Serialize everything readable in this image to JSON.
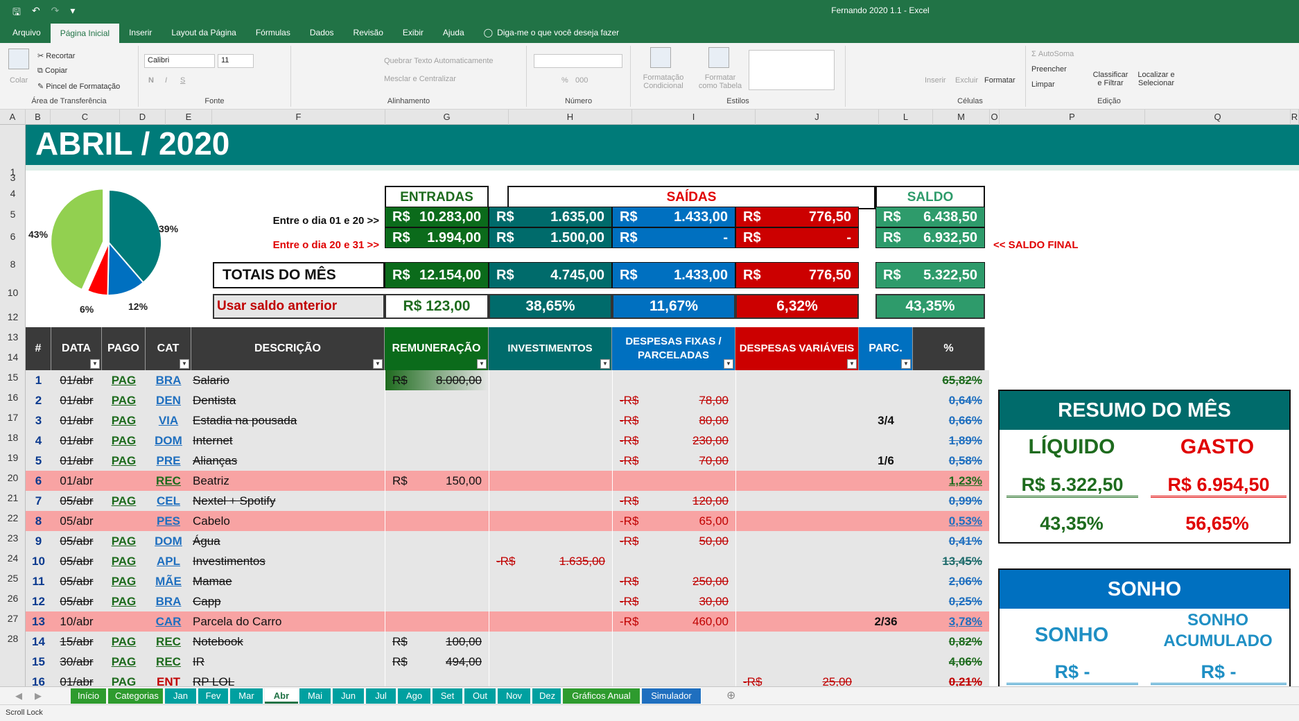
{
  "window": {
    "title": "Fernando 2020 1.1  -  Excel"
  },
  "menu": {
    "items": [
      "Arquivo",
      "Página Inicial",
      "Inserir",
      "Layout da Página",
      "Fórmulas",
      "Dados",
      "Revisão",
      "Exibir",
      "Ajuda"
    ],
    "tell_me": "Diga-me o que você deseja fazer"
  },
  "ribbon": {
    "clipboard": {
      "paste": "Colar",
      "cut": "Recortar",
      "copy": "Copiar",
      "painter": "Pincel de Formatação",
      "label": "Área de Transferência"
    },
    "font": {
      "name": "Calibri",
      "size": "11",
      "bold": "N",
      "italic": "I",
      "underline": "S",
      "label": "Fonte"
    },
    "alignment": {
      "wrap": "Quebrar Texto Automaticamente",
      "merge": "Mesclar e Centralizar",
      "label": "Alinhamento"
    },
    "number": {
      "label": "Número",
      "percent": "%",
      "thousands": "000"
    },
    "styles": {
      "conditional": "Formatação Condicional",
      "table": "Formatar como Tabela",
      "label": "Estilos"
    },
    "cells": {
      "insert": "Inserir",
      "delete": "Excluir",
      "format": "Formatar",
      "label": "Células"
    },
    "editing": {
      "autosum": "AutoSoma",
      "fill": "Preencher",
      "clear": "Limpar",
      "sort": "Classificar e Filtrar",
      "find": "Localizar e Selecionar",
      "label": "Edição"
    }
  },
  "columns": [
    "A",
    "B",
    "C",
    "D",
    "E",
    "F",
    "G",
    "H",
    "I",
    "J",
    "L",
    "M",
    "O",
    "P",
    "Q",
    "R"
  ],
  "rows": [
    "1",
    "3",
    "4",
    "5",
    "6",
    "8",
    "10",
    "12",
    "13",
    "14",
    "15",
    "16",
    "17",
    "18",
    "19",
    "20",
    "21",
    "22",
    "23",
    "24",
    "25",
    "26",
    "27",
    "28"
  ],
  "sheet": {
    "title": "ABRIL / 2020",
    "pie": {
      "labels": [
        "43%",
        "39%",
        "12%",
        "6%"
      ],
      "values": [
        43.35,
        38.65,
        11.67,
        6.32
      ],
      "colors": [
        "#92d050",
        "#007b79",
        "#0070c0",
        "#ff0000"
      ]
    },
    "summary": {
      "entradas": "ENTRADAS",
      "saidas": "SAÍDAS",
      "saldo": "SALDO",
      "row1_label": "Entre o dia 01 e 20 >>",
      "row2_label": "Entre o dia 20 e 31 >>",
      "currency": "R$",
      "row1": [
        "10.283,00",
        "1.635,00",
        "1.433,00",
        "776,50",
        "6.438,50"
      ],
      "row2": [
        "1.994,00",
        "1.500,00",
        "-",
        "-",
        "6.932,50"
      ],
      "saldo_final": "<< SALDO FINAL",
      "totais_label": "TOTAIS DO MÊS",
      "totais": [
        "12.154,00",
        "4.745,00",
        "1.433,00",
        "776,50",
        "5.322,50"
      ],
      "usar_saldo": "Usar saldo anterior",
      "usar_saldo_value": "R$   123,00",
      "percents": [
        "38,65%",
        "11,67%",
        "6,32%",
        "43,35%"
      ]
    },
    "table_headers": [
      "#",
      "DATA",
      "PAGO",
      "CAT",
      "DESCRIÇÃO",
      "REMUNERAÇÃO",
      "INVESTIMENTOS",
      "DESPESAS FIXAS / PARCELADAS",
      "DESPESAS VARIÁVEIS",
      "PARC.",
      "%"
    ],
    "entries": [
      {
        "n": "1",
        "date": "01/abr",
        "pago": "PAG",
        "cat": "BRA",
        "desc": "Salario",
        "rem": "8.000,00",
        "inv": "",
        "fix": "",
        "var": "",
        "parc": "",
        "pct": "65,82%",
        "style": "gry",
        "strike": true,
        "pcolor": "#1e6b1e"
      },
      {
        "n": "2",
        "date": "01/abr",
        "pago": "PAG",
        "cat": "DEN",
        "desc": "Dentista",
        "rem": "",
        "inv": "",
        "fix": "78,00",
        "var": "",
        "parc": "",
        "pct": "0,64%",
        "style": "gry",
        "strike": true,
        "pcolor": "#1f6fbf"
      },
      {
        "n": "3",
        "date": "01/abr",
        "pago": "PAG",
        "cat": "VIA",
        "desc": "Estadia na pousada",
        "rem": "",
        "inv": "",
        "fix": "80,00",
        "var": "",
        "parc": "3/4",
        "pct": "0,66%",
        "style": "gry",
        "strike": true,
        "pcolor": "#1f6fbf"
      },
      {
        "n": "4",
        "date": "01/abr",
        "pago": "PAG",
        "cat": "DOM",
        "desc": "Internet",
        "rem": "",
        "inv": "",
        "fix": "230,00",
        "var": "",
        "parc": "",
        "pct": "1,89%",
        "style": "gry",
        "strike": true,
        "pcolor": "#1f6fbf"
      },
      {
        "n": "5",
        "date": "01/abr",
        "pago": "PAG",
        "cat": "PRE",
        "desc": "Alianças",
        "rem": "",
        "inv": "",
        "fix": "70,00",
        "var": "",
        "parc": "1/6",
        "pct": "0,58%",
        "style": "gry",
        "strike": true,
        "pcolor": "#1f6fbf"
      },
      {
        "n": "6",
        "date": "01/abr",
        "pago": "",
        "cat": "REC",
        "desc": "Beatriz",
        "rem": "150,00",
        "inv": "",
        "fix": "",
        "var": "",
        "parc": "",
        "pct": "1,23%",
        "style": "pnk",
        "strike": false,
        "pcolor": "#1e6b1e"
      },
      {
        "n": "7",
        "date": "05/abr",
        "pago": "PAG",
        "cat": "CEL",
        "desc": "Nextel + Spotify",
        "rem": "",
        "inv": "",
        "fix": "120,00",
        "var": "",
        "parc": "",
        "pct": "0,99%",
        "style": "gry",
        "strike": true,
        "pcolor": "#1f6fbf"
      },
      {
        "n": "8",
        "date": "05/abr",
        "pago": "",
        "cat": "PES",
        "desc": "Cabelo",
        "rem": "",
        "inv": "",
        "fix": "65,00",
        "var": "",
        "parc": "",
        "pct": "0,53%",
        "style": "pnk",
        "strike": false,
        "pcolor": "#1f6fbf"
      },
      {
        "n": "9",
        "date": "05/abr",
        "pago": "PAG",
        "cat": "DOM",
        "desc": "Água",
        "rem": "",
        "inv": "",
        "fix": "50,00",
        "var": "",
        "parc": "",
        "pct": "0,41%",
        "style": "gry",
        "strike": true,
        "pcolor": "#1f6fbf"
      },
      {
        "n": "10",
        "date": "05/abr",
        "pago": "PAG",
        "cat": "APL",
        "desc": "Investimentos",
        "rem": "",
        "inv": "1.635,00",
        "fix": "",
        "var": "",
        "parc": "",
        "pct": "13,45%",
        "style": "gry",
        "strike": true,
        "pcolor": "#1e6b6b"
      },
      {
        "n": "11",
        "date": "05/abr",
        "pago": "PAG",
        "cat": "MÃE",
        "desc": "Mamae",
        "rem": "",
        "inv": "",
        "fix": "250,00",
        "var": "",
        "parc": "",
        "pct": "2,06%",
        "style": "gry",
        "strike": true,
        "pcolor": "#1f6fbf"
      },
      {
        "n": "12",
        "date": "05/abr",
        "pago": "PAG",
        "cat": "BRA",
        "desc": "Capp",
        "rem": "",
        "inv": "",
        "fix": "30,00",
        "var": "",
        "parc": "",
        "pct": "0,25%",
        "style": "gry",
        "strike": true,
        "pcolor": "#1f6fbf"
      },
      {
        "n": "13",
        "date": "10/abr",
        "pago": "",
        "cat": "CAR",
        "desc": "Parcela do Carro",
        "rem": "",
        "inv": "",
        "fix": "460,00",
        "var": "",
        "parc": "2/36",
        "pct": "3,78%",
        "style": "pnk",
        "strike": false,
        "pcolor": "#1f6fbf"
      },
      {
        "n": "14",
        "date": "15/abr",
        "pago": "PAG",
        "cat": "REC",
        "desc": "Notebook",
        "rem": "100,00",
        "inv": "",
        "fix": "",
        "var": "",
        "parc": "",
        "pct": "0,82%",
        "style": "gry",
        "strike": true,
        "pcolor": "#1e6b1e"
      },
      {
        "n": "15",
        "date": "30/abr",
        "pago": "PAG",
        "cat": "REC",
        "desc": "IR",
        "rem": "494,00",
        "inv": "",
        "fix": "",
        "var": "",
        "parc": "",
        "pct": "4,06%",
        "style": "gry",
        "strike": true,
        "pcolor": "#1e6b1e"
      },
      {
        "n": "16",
        "date": "01/abr",
        "pago": "PAG",
        "cat": "ENT",
        "desc": "RP LOL",
        "rem": "",
        "inv": "",
        "fix": "",
        "var": "25,00",
        "parc": "",
        "pct": "0,21%",
        "style": "gry",
        "strike": true,
        "pcolor": "#c00000"
      }
    ],
    "resumo": {
      "title": "RESUMO DO MÊS",
      "liquido": "LÍQUIDO",
      "gasto": "GASTO",
      "liquido_value": "R$  5.322,50",
      "gasto_value": "R$  6.954,50",
      "liquido_pct": "43,35%",
      "gasto_pct": "56,65%"
    },
    "sonho": {
      "title": "SONHO",
      "label1": "SONHO",
      "label2": "SONHO ACUMULADO",
      "value1": "R$     -",
      "value2": "R$     -"
    }
  },
  "tabs": [
    {
      "name": "Início",
      "color": "#2e9b2e"
    },
    {
      "name": "Categorias",
      "color": "#2e9b2e"
    },
    {
      "name": "Jan",
      "color": "#00a0a0"
    },
    {
      "name": "Fev",
      "color": "#00a0a0"
    },
    {
      "name": "Mar",
      "color": "#00a0a0"
    },
    {
      "name": "Abr",
      "color": "#ffffff",
      "active": true
    },
    {
      "name": "Mai",
      "color": "#00a0a0"
    },
    {
      "name": "Jun",
      "color": "#00a0a0"
    },
    {
      "name": "Jul",
      "color": "#00a0a0"
    },
    {
      "name": "Ago",
      "color": "#00a0a0"
    },
    {
      "name": "Set",
      "color": "#00a0a0"
    },
    {
      "name": "Out",
      "color": "#00a0a0"
    },
    {
      "name": "Nov",
      "color": "#00a0a0"
    },
    {
      "name": "Dez",
      "color": "#00a0a0"
    },
    {
      "name": "Gráficos Anual",
      "color": "#2e9b2e"
    },
    {
      "name": "Simulador",
      "color": "#1f6fbf"
    }
  ],
  "status": {
    "text": "Scroll Lock"
  }
}
